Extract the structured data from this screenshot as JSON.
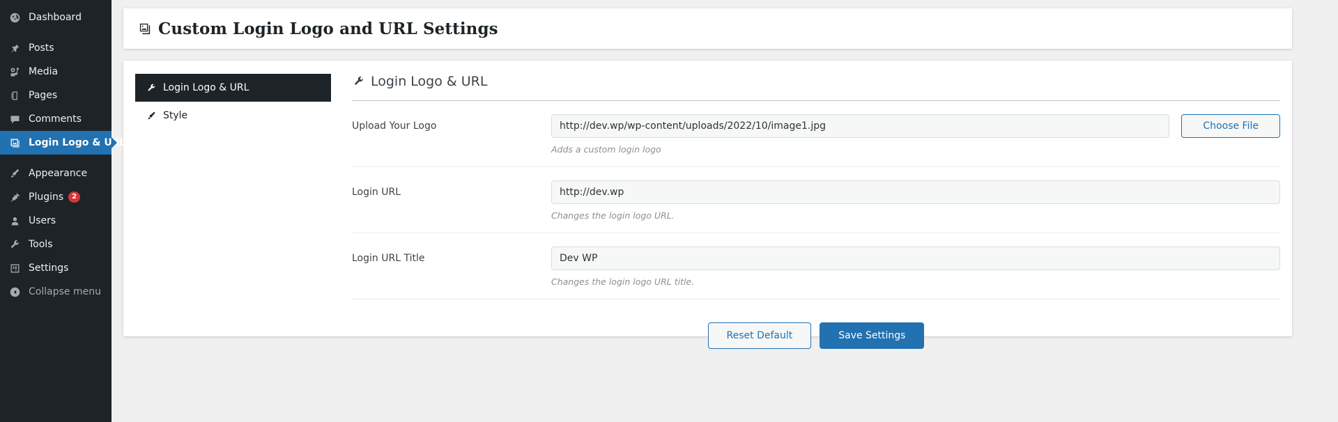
{
  "colors": {
    "accent": "#2271b1",
    "sidebar_bg": "#1d2327",
    "badge": "#d63638",
    "page_bg": "#f0f0f1"
  },
  "sidebar": {
    "items": [
      {
        "label": "Dashboard",
        "icon": "dashboard-icon",
        "current": false,
        "spaced": false,
        "dim": false
      },
      {
        "label": "Posts",
        "icon": "pin-icon",
        "current": false,
        "spaced": true,
        "dim": false
      },
      {
        "label": "Media",
        "icon": "media-icon",
        "current": false,
        "spaced": false,
        "dim": false
      },
      {
        "label": "Pages",
        "icon": "pages-icon",
        "current": false,
        "spaced": false,
        "dim": false
      },
      {
        "label": "Comments",
        "icon": "comment-icon",
        "current": false,
        "spaced": false,
        "dim": false
      },
      {
        "label": "Login Logo & URL",
        "icon": "images-icon",
        "current": true,
        "spaced": false,
        "dim": false
      },
      {
        "label": "Appearance",
        "icon": "brush-icon",
        "current": false,
        "spaced": true,
        "dim": false
      },
      {
        "label": "Plugins",
        "icon": "plug-icon",
        "current": false,
        "spaced": false,
        "dim": false,
        "badge": "2"
      },
      {
        "label": "Users",
        "icon": "user-icon",
        "current": false,
        "spaced": false,
        "dim": false
      },
      {
        "label": "Tools",
        "icon": "wrench-icon",
        "current": false,
        "spaced": false,
        "dim": false
      },
      {
        "label": "Settings",
        "icon": "sliders-icon",
        "current": false,
        "spaced": false,
        "dim": false
      },
      {
        "label": "Collapse menu",
        "icon": "collapse-arrow-icon",
        "current": false,
        "spaced": false,
        "dim": true
      }
    ]
  },
  "header": {
    "title": "Custom Login Logo and URL Settings",
    "icon": "images-icon"
  },
  "tabs": [
    {
      "label": "Login Logo & URL",
      "icon": "wrench-icon",
      "active": true
    },
    {
      "label": "Style",
      "icon": "brush-icon",
      "active": false
    }
  ],
  "panel": {
    "title": "Login Logo & URL",
    "icon": "wrench-icon",
    "fields": [
      {
        "label": "Upload Your Logo",
        "value": "http://dev.wp/wp-content/uploads/2022/10/image1.jpg",
        "placeholder": "",
        "hint": "Adds a custom login logo",
        "button": "Choose File"
      },
      {
        "label": "Login URL",
        "value": "http://dev.wp",
        "placeholder": "",
        "hint": "Changes the login logo URL."
      },
      {
        "label": "Login URL Title",
        "value": "Dev WP",
        "placeholder": "",
        "hint": "Changes the login logo URL title."
      }
    ],
    "actions": {
      "reset": "Reset Default",
      "save": "Save Settings"
    }
  }
}
